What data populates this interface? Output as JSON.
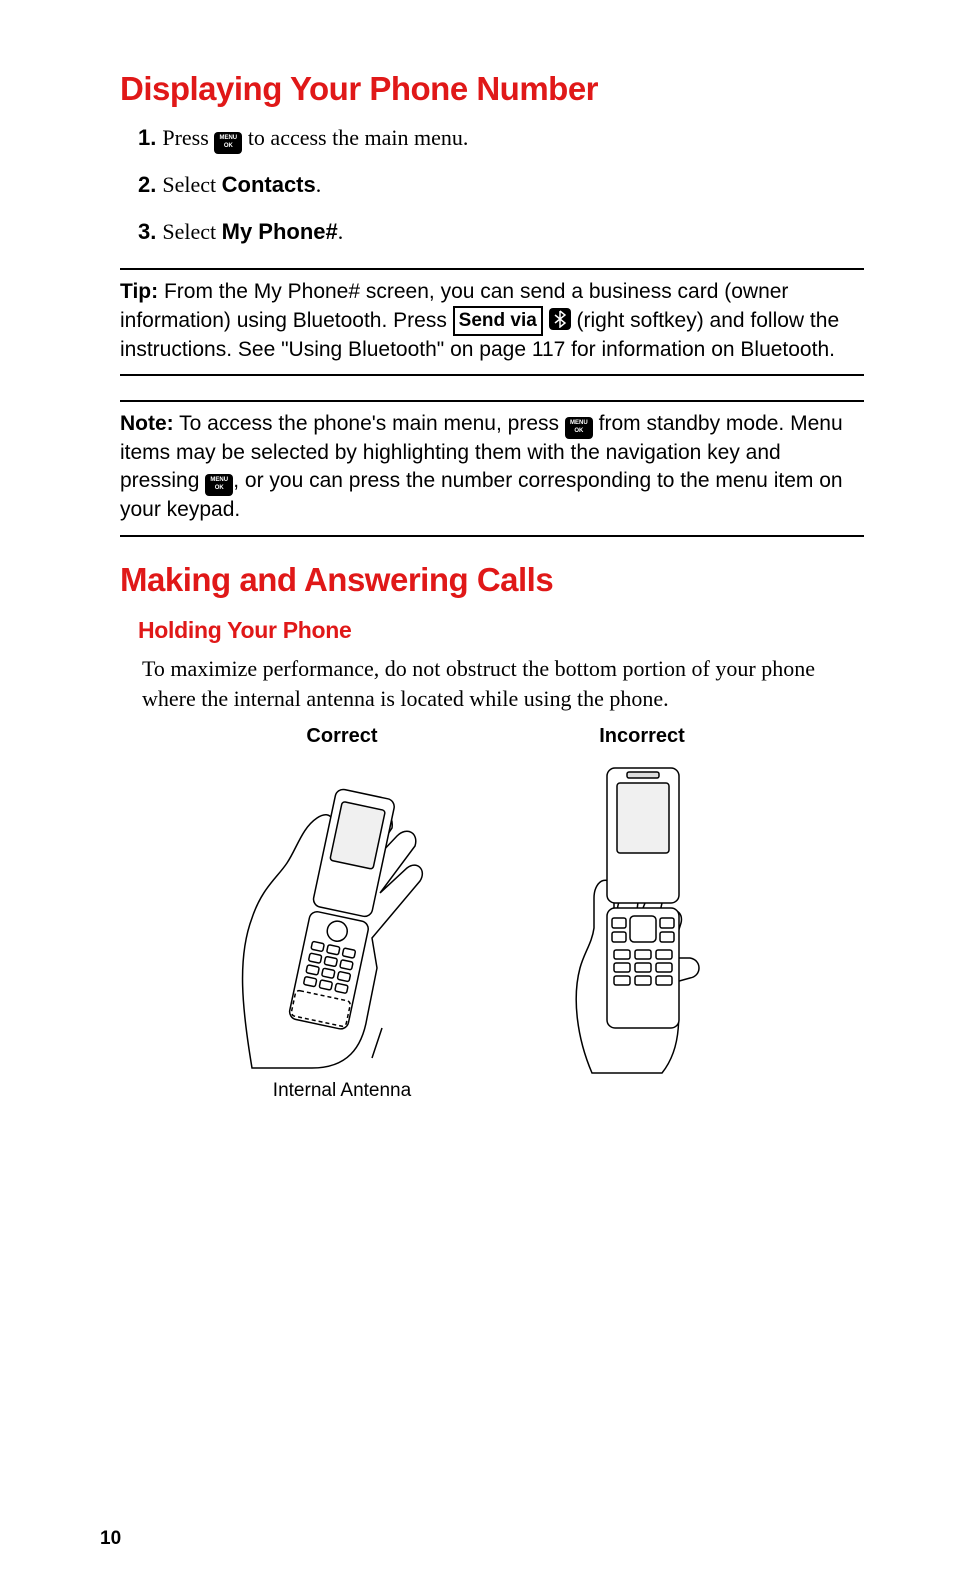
{
  "heading1": "Displaying Your Phone Number",
  "steps": [
    {
      "num": "1.",
      "pre": "Press ",
      "post": " to access the main menu."
    },
    {
      "num": "2.",
      "pre": "Select ",
      "bold": "Contacts",
      "post": "."
    },
    {
      "num": "3.",
      "pre": "Select ",
      "bold": "My Phone#",
      "post": "."
    }
  ],
  "tip": {
    "label": "Tip:",
    "part1": " From the My Phone# screen, you can send a business card (owner information) using Bluetooth. Press ",
    "sendvia": "Send via",
    "part2": " (right softkey) and follow the instructions. See \"Using Bluetooth\" on page 117 for information on Bluetooth."
  },
  "note": {
    "label": "Note:",
    "part1": " To access the phone's main menu, press ",
    "part2": " from standby mode. Menu items may be selected by highlighting them with the navigation key and pressing ",
    "part3": ", or you can press the number corresponding to the menu item on your keypad."
  },
  "heading2": "Making and Answering Calls",
  "subheading": "Holding Your Phone",
  "body1": "To maximize performance, do not obstruct the bottom portion of your phone where the internal antenna is located while using the phone.",
  "figure": {
    "left_caption": "Correct",
    "right_caption": "Incorrect",
    "antenna_label": "Internal Antenna"
  },
  "page_number": "10"
}
